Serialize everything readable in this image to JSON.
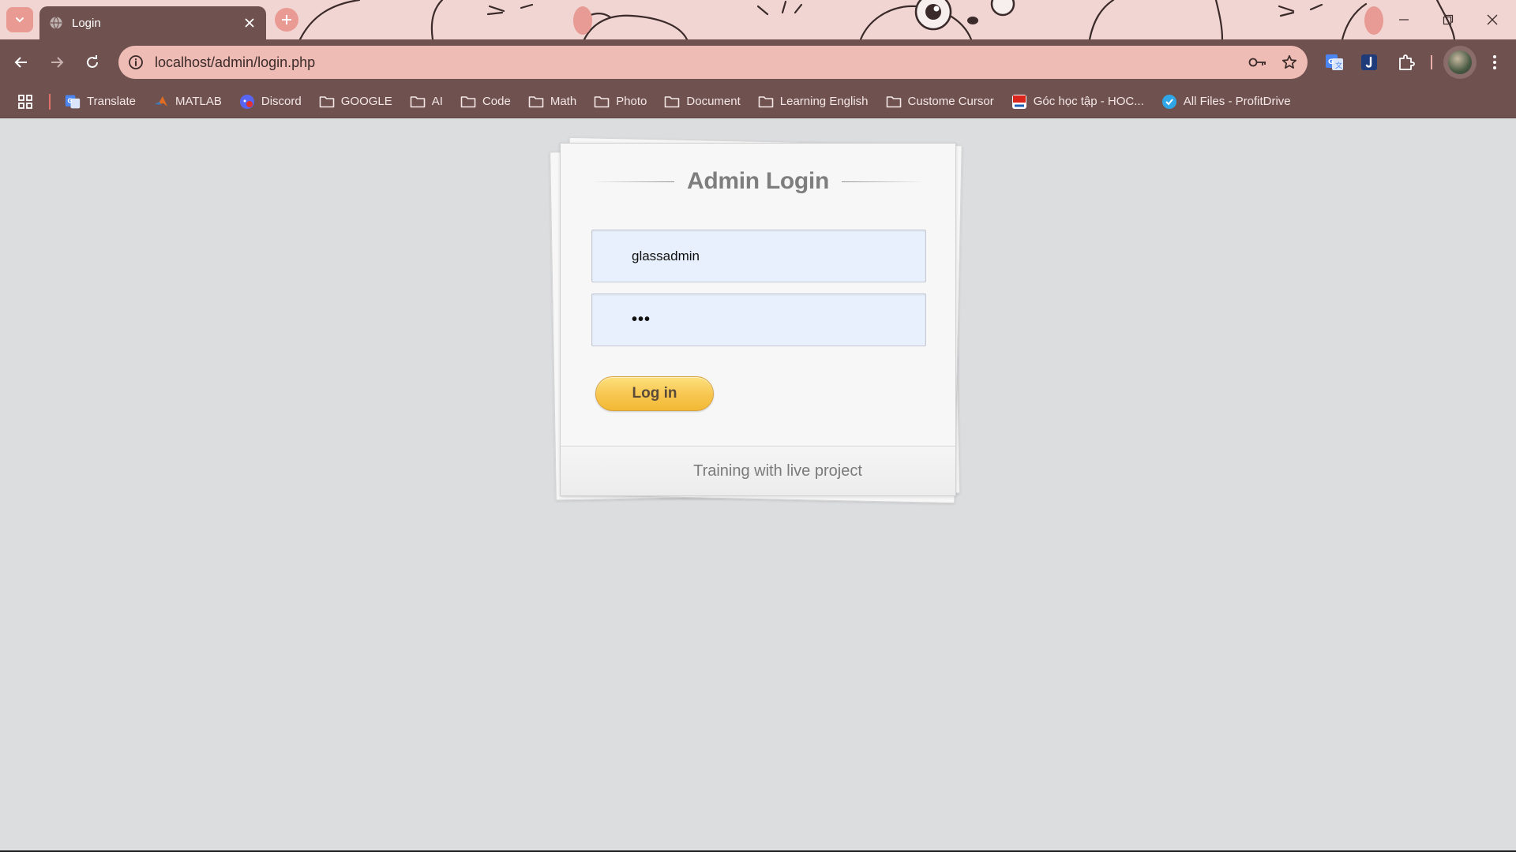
{
  "browser": {
    "tab": {
      "title": "Login"
    },
    "address_bar": {
      "url": "localhost/admin/login.php"
    },
    "bookmarks": [
      {
        "label": "Translate",
        "icon": "google-translate-icon"
      },
      {
        "label": "MATLAB",
        "icon": "matlab-icon"
      },
      {
        "label": "Discord",
        "icon": "discord-icon"
      },
      {
        "label": "GOOGLE",
        "icon": "folder-icon"
      },
      {
        "label": "AI",
        "icon": "folder-icon"
      },
      {
        "label": "Code",
        "icon": "folder-icon"
      },
      {
        "label": "Math",
        "icon": "folder-icon"
      },
      {
        "label": "Photo",
        "icon": "folder-icon"
      },
      {
        "label": "Document",
        "icon": "folder-icon"
      },
      {
        "label": "Learning English",
        "icon": "folder-icon"
      },
      {
        "label": "Custome Cursor",
        "icon": "folder-icon"
      },
      {
        "label": "Góc học tập - HOC...",
        "icon": "hocmai-icon"
      },
      {
        "label": "All Files - ProfitDrive",
        "icon": "profitdrive-icon"
      }
    ],
    "theme_colors": {
      "frame": "#6f5250",
      "omnibox": "#efbcb5",
      "accent": "#e99a92"
    }
  },
  "login": {
    "title": "Admin Login",
    "username_value": "glassadmin",
    "password_masked": "•••",
    "submit_label": "Log in",
    "footer_text": "Training with live project",
    "button_color": "#f7c64f"
  }
}
